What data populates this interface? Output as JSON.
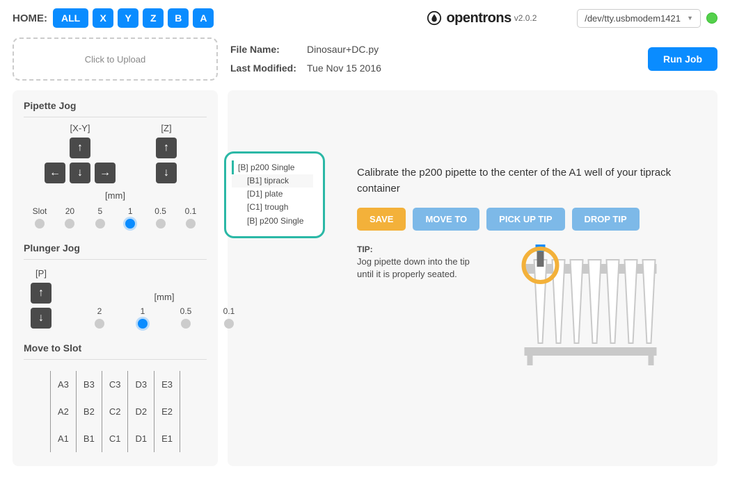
{
  "topbar": {
    "home_label": "HOME:",
    "home_buttons": [
      "ALL",
      "X",
      "Y",
      "Z",
      "B",
      "A"
    ],
    "brand": "opentrons",
    "version": "v2.0.2",
    "port": "/dev/tty.usbmodem1421"
  },
  "upload": {
    "placeholder": "Click to Upload"
  },
  "fileinfo": {
    "name_label": "File Name:",
    "name_value": "Dinosaur+DC.py",
    "modified_label": "Last Modified:",
    "modified_value": "Tue Nov 15 2016",
    "run_label": "Run Job"
  },
  "pipette_jog": {
    "title": "Pipette Jog",
    "xy_label": "[X-Y]",
    "z_label": "[Z]",
    "mm_label": "[mm]",
    "slot_label": "Slot",
    "steps": [
      "20",
      "5",
      "1",
      "0.5",
      "0.1"
    ],
    "selected_step": 2
  },
  "plunger_jog": {
    "title": "Plunger Jog",
    "p_label": "[P]",
    "mm_label": "[mm]",
    "steps": [
      "2",
      "1",
      "0.5",
      "0.1"
    ],
    "selected_step": 1
  },
  "move_to_slot": {
    "title": "Move to Slot",
    "grid": [
      [
        "A3",
        "B3",
        "C3",
        "D3",
        "E3"
      ],
      [
        "A2",
        "B2",
        "C2",
        "D2",
        "E2"
      ],
      [
        "A1",
        "B1",
        "C1",
        "D1",
        "E1"
      ]
    ]
  },
  "tree": {
    "root": "[B] p200 Single",
    "items": [
      {
        "label": "[B1] tiprack",
        "selected": true
      },
      {
        "label": "[D1] plate",
        "selected": false
      },
      {
        "label": "[C1] trough",
        "selected": false
      },
      {
        "label": "[B] p200 Single",
        "selected": false
      }
    ]
  },
  "calibration": {
    "instruction": "Calibrate the p200 pipette to the center of the A1 well of your tiprack container",
    "buttons": {
      "save": "SAVE",
      "move_to": "MOVE TO",
      "pick_up": "PICK UP TIP",
      "drop": "DROP TIP"
    },
    "tip_title": "TIP:",
    "tip_body": "Jog pipette down into the tip until it is properly seated."
  }
}
